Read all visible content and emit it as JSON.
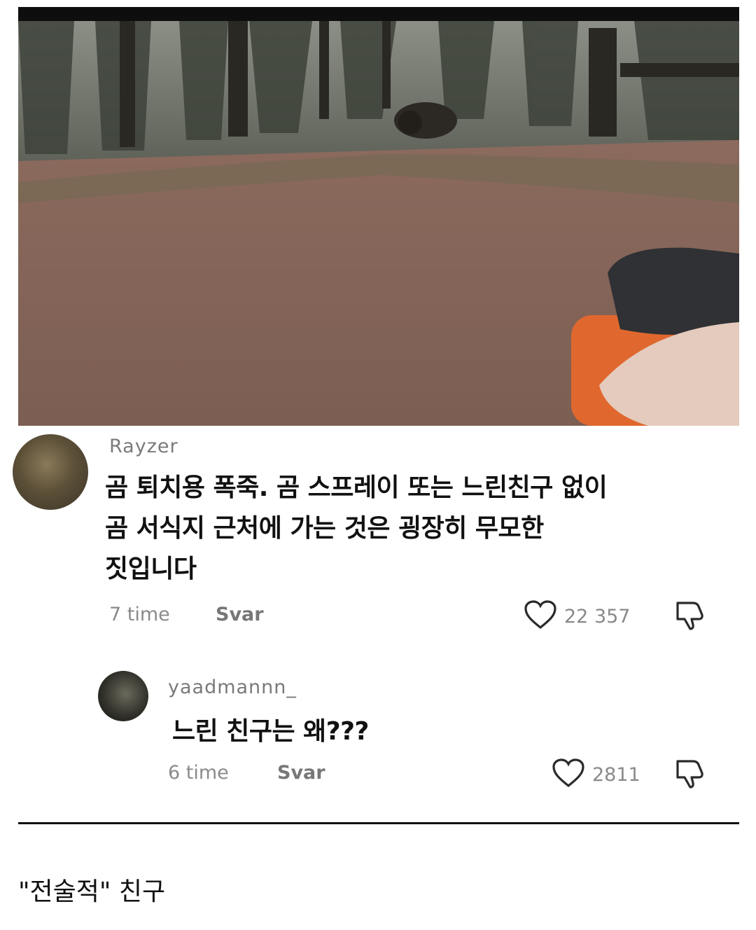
{
  "post": {
    "video": {
      "description_icon": "bear-trail-video-frame"
    },
    "comments": [
      {
        "username": "Rayzer",
        "text_lines": [
          "곰 퇴치용 폭죽. 곰 스프레이 또는 느린친구 없이",
          "곰 서식지 근처에 가는 것은 굉장히 무모한",
          "짓입니다"
        ],
        "time": "7 time",
        "reply_label": "Svar",
        "likes": "22 357"
      },
      {
        "username": "yaadmannn_",
        "text": "느린 친구는 왜???",
        "time": "6 time",
        "reply_label": "Svar",
        "likes": "2811"
      }
    ]
  },
  "caption": "\"전술적\" 친구",
  "icons": {
    "like": "heart-outline-icon",
    "dislike": "thumbs-down-icon"
  },
  "colors": {
    "text_primary": "#111111",
    "text_secondary": "#8a8a8a",
    "top_bar": "#0e0e0e"
  }
}
